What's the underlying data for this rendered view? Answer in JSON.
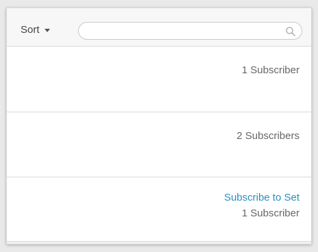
{
  "toolbar": {
    "sort_label": "Sort",
    "search_placeholder": "",
    "search_value": ""
  },
  "rows": [
    {
      "subscriber_count": "1 Subscriber"
    },
    {
      "subscriber_count": "2 Subscribers"
    },
    {
      "action_label": "Subscribe to Set",
      "subscriber_count": "1 Subscriber"
    }
  ],
  "colors": {
    "link": "#2a8fbd",
    "text": "#666666",
    "background": "#e9e9e9"
  },
  "icons": {
    "search": "search-icon",
    "sort": "chevron-down-icon"
  }
}
